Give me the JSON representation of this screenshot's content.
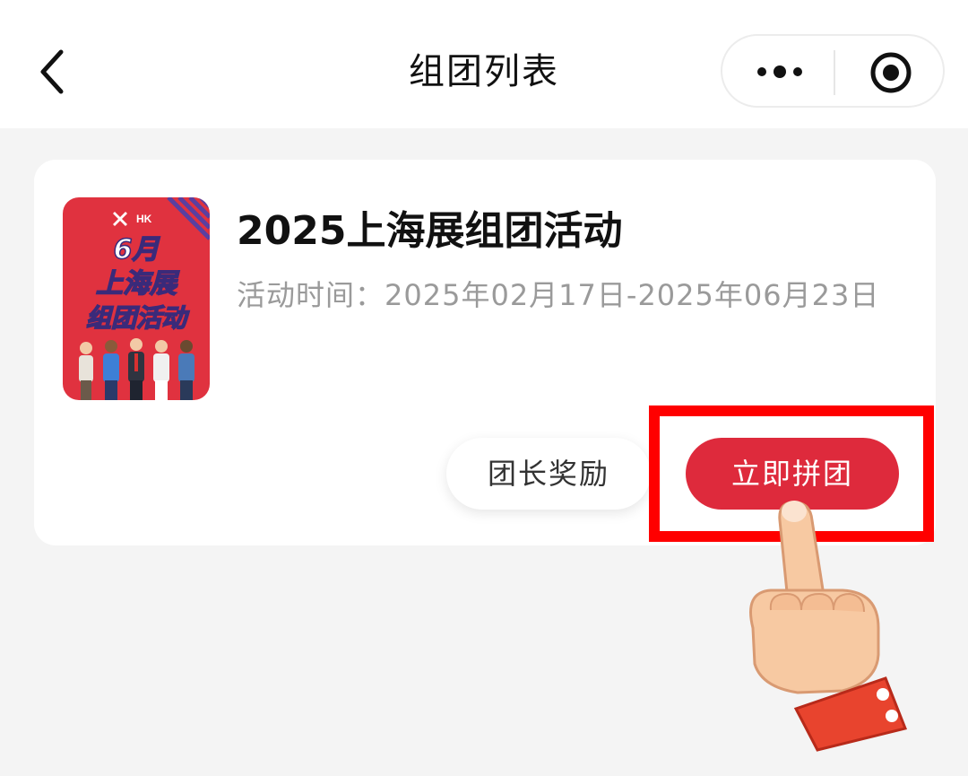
{
  "header": {
    "title": "组团列表",
    "back_icon": "chevron-left-icon",
    "more_icon": "more-dots-icon",
    "close_icon": "target-circle-icon"
  },
  "activity": {
    "title": "2025上海展组团活动",
    "time_label": "活动时间：",
    "time_value": "2025年02月17日-2025年06月23日",
    "poster": {
      "line1": "6月",
      "line2": "上海展",
      "line3": "组团活动",
      "background": "#e0323f"
    },
    "buttons": {
      "reward": "团长奖励",
      "join": "立即拼团"
    }
  },
  "colors": {
    "accent": "#de2a3c",
    "highlight": "#ff0000",
    "page_bg": "#f4f4f4"
  }
}
